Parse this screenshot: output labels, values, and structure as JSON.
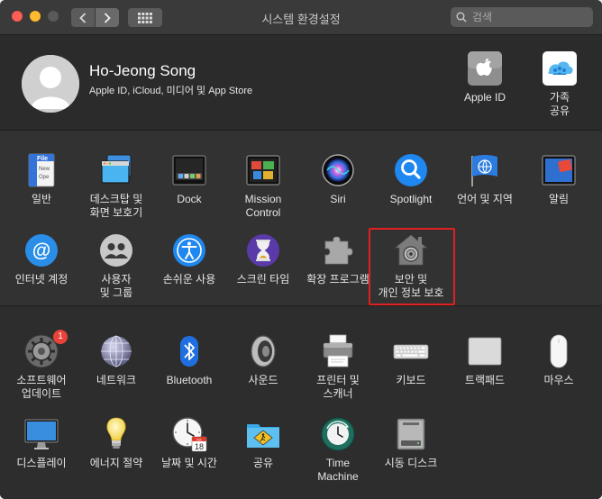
{
  "window": {
    "title": "시스템 환경설정",
    "search": {
      "placeholder": "검색",
      "value": ""
    }
  },
  "account": {
    "name": "Ho-Jeong Song",
    "subtitle": "Apple ID, iCloud, 미디어 및 App Store",
    "items": [
      {
        "id": "apple-id",
        "label": "Apple ID",
        "icon": "apple-logo-icon"
      },
      {
        "id": "family",
        "label": "가족\n공유",
        "icon": "family-sharing-icon"
      }
    ]
  },
  "section1": [
    {
      "id": "general",
      "label": "일반",
      "icon": "general-file-icon"
    },
    {
      "id": "desktop",
      "label": "데스크탑 및\n화면 보호기",
      "icon": "desktop-screensaver-icon"
    },
    {
      "id": "dock",
      "label": "Dock",
      "icon": "dock-icon"
    },
    {
      "id": "mission",
      "label": "Mission\nControl",
      "icon": "mission-control-icon"
    },
    {
      "id": "siri",
      "label": "Siri",
      "icon": "siri-icon"
    },
    {
      "id": "spotlight",
      "label": "Spotlight",
      "icon": "spotlight-icon"
    },
    {
      "id": "language",
      "label": "언어 및 지역",
      "icon": "language-region-icon"
    },
    {
      "id": "notifications",
      "label": "알림",
      "icon": "notifications-icon"
    },
    {
      "id": "internet",
      "label": "인터넷 계정",
      "icon": "internet-accounts-icon"
    },
    {
      "id": "users",
      "label": "사용자\n및 그룹",
      "icon": "users-groups-icon"
    },
    {
      "id": "accessibility",
      "label": "손쉬운 사용",
      "icon": "accessibility-icon"
    },
    {
      "id": "screentime",
      "label": "스크린 타임",
      "icon": "screen-time-icon"
    },
    {
      "id": "extensions",
      "label": "확장 프로그램",
      "icon": "extensions-icon"
    },
    {
      "id": "security",
      "label": "보안 및\n개인 정보 보호",
      "icon": "security-privacy-icon"
    }
  ],
  "section2": [
    {
      "id": "software-update",
      "label": "소프트웨어\n업데이트",
      "icon": "software-update-icon",
      "badge": "1"
    },
    {
      "id": "network",
      "label": "네트워크",
      "icon": "network-icon"
    },
    {
      "id": "bluetooth",
      "label": "Bluetooth",
      "icon": "bluetooth-icon"
    },
    {
      "id": "sound",
      "label": "사운드",
      "icon": "sound-icon"
    },
    {
      "id": "printers",
      "label": "프린터 및\n스캐너",
      "icon": "printers-scanners-icon"
    },
    {
      "id": "keyboard",
      "label": "키보드",
      "icon": "keyboard-icon"
    },
    {
      "id": "trackpad",
      "label": "트랙패드",
      "icon": "trackpad-icon"
    },
    {
      "id": "mouse",
      "label": "마우스",
      "icon": "mouse-icon"
    },
    {
      "id": "displays",
      "label": "디스플레이",
      "icon": "displays-icon"
    },
    {
      "id": "energy",
      "label": "에너지 절약",
      "icon": "energy-saver-icon"
    },
    {
      "id": "datetime",
      "label": "날짜 및 시간",
      "icon": "date-time-icon",
      "calendar_month": "JUL",
      "calendar_day": "18"
    },
    {
      "id": "sharing",
      "label": "공유",
      "icon": "sharing-icon"
    },
    {
      "id": "timemachine",
      "label": "Time\nMachine",
      "icon": "time-machine-icon"
    },
    {
      "id": "startup",
      "label": "시동 디스크",
      "icon": "startup-disk-icon"
    }
  ],
  "colors": {
    "window_bg": "#323232",
    "highlight": "#e02020",
    "badge": "#e8423a",
    "accent_blue": "#1f87f0"
  }
}
